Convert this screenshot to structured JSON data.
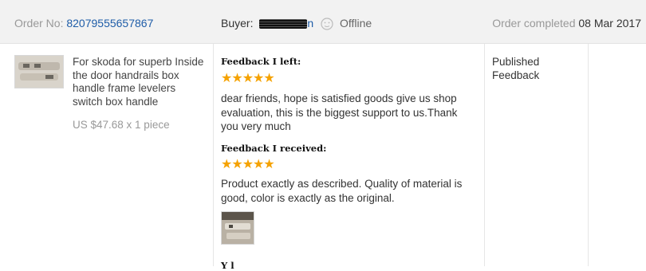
{
  "header": {
    "order_label": "Order No:",
    "order_number": "82079555657867",
    "buyer_label": "Buyer:",
    "buyer_name_tail": "n",
    "buyer_status": "Offline",
    "completed_label": "Order completed",
    "completed_date": "08 Mar 2017"
  },
  "product": {
    "title": "For skoda for superb Inside the door handrails box handle frame levelers switch box handle",
    "price": "US $47.68 x 1 piece"
  },
  "feedback_left": {
    "heading": "Feedback I left:",
    "stars": "★★★★★",
    "rating": 5,
    "text": "dear friends, hope is satisfied goods give us shop evaluation, this is the biggest support to us.Thank you very much"
  },
  "feedback_received": {
    "heading": "Feedback I received:",
    "stars": "★★★★★",
    "rating": 5,
    "text": "Product exactly as described. Quality of material is good, color is exactly as the original."
  },
  "next_heading": "Y l",
  "status": {
    "text": "Published Feedback"
  },
  "colors": {
    "star": "#f5a200",
    "link": "#1f5da8",
    "header_bg": "#f2f2f2"
  },
  "icons": {
    "offline": "offline-face-icon"
  }
}
